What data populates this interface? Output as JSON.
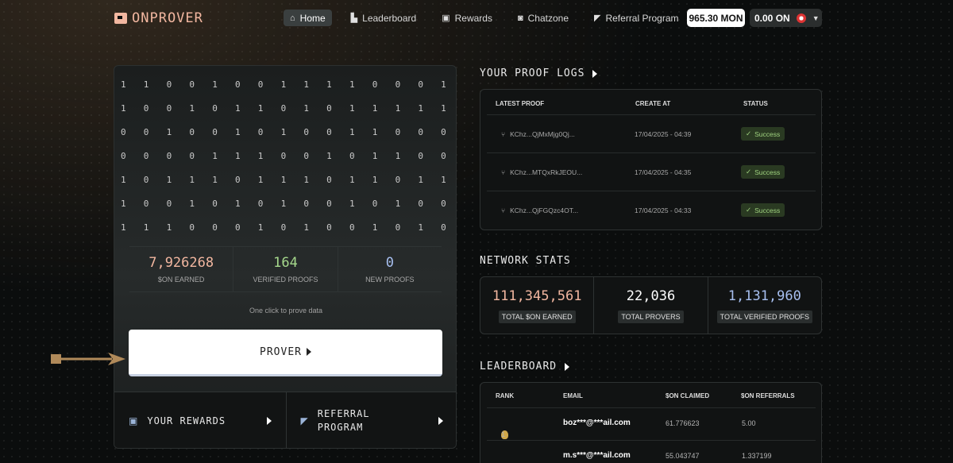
{
  "app": {
    "logo_text": "ONPROVER"
  },
  "nav": {
    "items": [
      {
        "label": "Home",
        "icon": "home-icon",
        "active": true
      },
      {
        "label": "Leaderboard",
        "icon": "leaderboard-icon"
      },
      {
        "label": "Rewards",
        "icon": "gift-icon"
      },
      {
        "label": "Chatzone",
        "icon": "chat-icon"
      },
      {
        "label": "Referral Program",
        "icon": "megaphone-icon"
      }
    ]
  },
  "balances": {
    "mon": "965.30 MON",
    "on": "0.00 ON"
  },
  "binary_grid": [
    [
      "1",
      "1",
      "0",
      "0",
      "1",
      "0",
      "0",
      "1",
      "1",
      "1",
      "1",
      "0",
      "0",
      "0",
      "1"
    ],
    [
      "1",
      "0",
      "0",
      "1",
      "0",
      "1",
      "1",
      "0",
      "1",
      "0",
      "1",
      "1",
      "1",
      "1",
      "1"
    ],
    [
      "0",
      "0",
      "1",
      "0",
      "0",
      "1",
      "0",
      "1",
      "0",
      "0",
      "1",
      "1",
      "0",
      "0",
      "0"
    ],
    [
      "0",
      "0",
      "0",
      "0",
      "1",
      "1",
      "1",
      "0",
      "0",
      "1",
      "0",
      "1",
      "1",
      "0",
      "0"
    ],
    [
      "1",
      "0",
      "1",
      "1",
      "1",
      "0",
      "1",
      "1",
      "1",
      "0",
      "1",
      "1",
      "0",
      "1",
      "1"
    ],
    [
      "1",
      "0",
      "0",
      "1",
      "0",
      "1",
      "0",
      "1",
      "0",
      "0",
      "1",
      "0",
      "1",
      "0",
      "0"
    ],
    [
      "1",
      "1",
      "1",
      "0",
      "0",
      "0",
      "1",
      "0",
      "1",
      "0",
      "0",
      "1",
      "0",
      "1",
      "0"
    ]
  ],
  "prover": {
    "stats": [
      {
        "value": "7,926268",
        "label": "$ON EARNED",
        "color": "#f2b7a0"
      },
      {
        "value": "164",
        "label": "VERIFIED PROOFS",
        "color": "#a6d98c"
      },
      {
        "value": "0",
        "label": "NEW PROOFS",
        "color": "#a7bff0"
      }
    ],
    "hint": "One click to prove data",
    "button_label": "PROVER",
    "rewards_label": "YOUR REWARDS",
    "referral_label_1": "REFERRAL",
    "referral_label_2": "PROGRAM"
  },
  "proof_logs": {
    "title": "YOUR PROOF LOGS",
    "columns": [
      "LATEST PROOF",
      "CREATE AT",
      "STATUS"
    ],
    "rows": [
      {
        "proof": "KChz...QjMxMjg0Qj...",
        "created": "17/04/2025 - 04:39",
        "status": "Success"
      },
      {
        "proof": "KChz...MTQxRkJEOU...",
        "created": "17/04/2025 - 04:35",
        "status": "Success"
      },
      {
        "proof": "KChz...QjFGQzc4OT...",
        "created": "17/04/2025 - 04:33",
        "status": "Success"
      }
    ]
  },
  "network_stats": {
    "title": "NETWORK STATS",
    "items": [
      {
        "value": "111,345,561",
        "label": "TOTAL $ON EARNED",
        "color": "#f2b7a0"
      },
      {
        "value": "22,036",
        "label": "TOTAL PROVERS",
        "color": "#ffffff"
      },
      {
        "value": "1,131,960",
        "label": "TOTAL VERIFIED PROOFS",
        "color": "#a7bff0"
      }
    ]
  },
  "leaderboard": {
    "title": "LEADERBOARD",
    "columns": [
      "RANK",
      "EMAIL",
      "$ON CLAIMED",
      "$ON REFERRALS"
    ],
    "rows": [
      {
        "rank": "1",
        "email": "boz***@***ail.com",
        "claimed": "61.776623",
        "referrals": "5.00",
        "medal": "#d1a84a"
      },
      {
        "rank": "2",
        "email": "m.s***@***ail.com",
        "claimed": "55.043747",
        "referrals": "1.337199",
        "medal": "#b8b8b8"
      }
    ]
  }
}
